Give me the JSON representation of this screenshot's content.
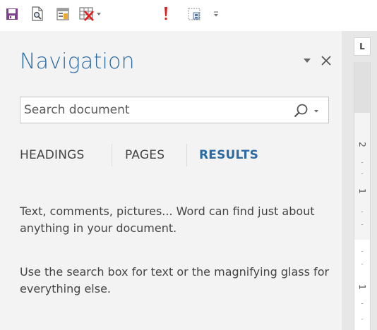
{
  "toolbar": {
    "items": [
      {
        "icon": "save-icon"
      },
      {
        "icon": "print-preview-icon"
      },
      {
        "icon": "form-icon"
      },
      {
        "icon": "delete-table-icon",
        "has_dropdown": true
      },
      {
        "icon": "exclamation-icon"
      },
      {
        "icon": "dialog-icon"
      },
      {
        "icon": "customize-toolbar-icon"
      }
    ]
  },
  "navigation": {
    "title": "Navigation",
    "search": {
      "placeholder": "Search document",
      "value": ""
    },
    "tabs": [
      {
        "label": "HEADINGS",
        "active": false
      },
      {
        "label": "PAGES",
        "active": false
      },
      {
        "label": "RESULTS",
        "active": true
      }
    ],
    "message_1": "Text, comments, pictures... Word can find just about anything in your document.",
    "message_2": "Use the search box for text or the magnifying glass for everything else."
  },
  "ruler": {
    "corner_label": "L",
    "numbers": [
      "2",
      "1",
      "1"
    ]
  },
  "colors": {
    "accent": "#2b6aa3",
    "pane_background": "#f3f3f3",
    "save_icon": "#7b3f8c",
    "alert_icon": "#e31c1c"
  }
}
